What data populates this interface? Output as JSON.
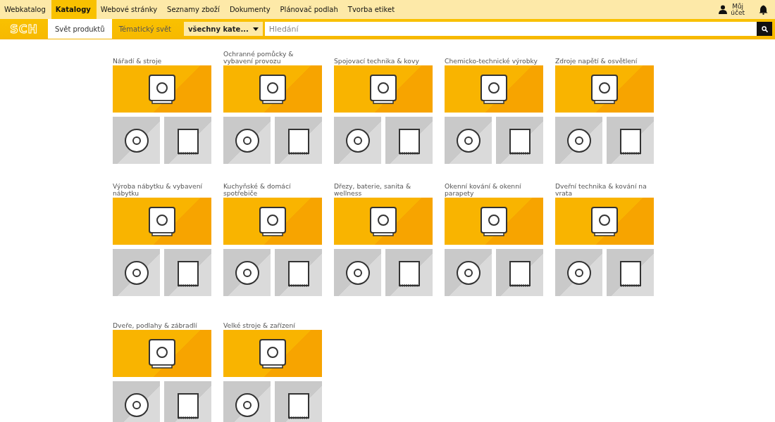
{
  "top_nav": {
    "items": [
      {
        "label": "Webkatalog",
        "selected": false
      },
      {
        "label": "Katalogy",
        "selected": true
      },
      {
        "label": "Webové stránky",
        "selected": false
      },
      {
        "label": "Seznamy zboží",
        "selected": false
      },
      {
        "label": "Dokumenty",
        "selected": false
      },
      {
        "label": "Plánovač podlah",
        "selected": false
      },
      {
        "label": "Tvorba etiket",
        "selected": false
      }
    ],
    "account": {
      "line1": "Můj",
      "line2": "účet"
    }
  },
  "logo": {
    "text": "SCH"
  },
  "sub_tabs": [
    {
      "label": "Svět produktů",
      "selected": true
    },
    {
      "label": "Tématický svět",
      "selected": false
    }
  ],
  "category_select": {
    "value": "všechny kate..."
  },
  "search": {
    "placeholder": "Hledání"
  },
  "categories": [
    {
      "title": "Nářadí & stroje"
    },
    {
      "title": "Ochranné pomůcky & vybavení provozu"
    },
    {
      "title": "Spojovací technika & kovy"
    },
    {
      "title": "Chemicko-technické výrobky"
    },
    {
      "title": "Zdroje napětí & osvětlení"
    },
    {
      "title": "Výroba nábytku & vybavení nábytku"
    },
    {
      "title": "Kuchyňské & domácí spotřebiče"
    },
    {
      "title": "Dřezy, baterie, sanita & wellness"
    },
    {
      "title": "Okenní kování & okenní parapety"
    },
    {
      "title": "Dveřní technika & kování na vrata"
    },
    {
      "title": "Dveře, podlahy & zábradlí"
    },
    {
      "title": "Velké stroje & zařízení"
    }
  ]
}
